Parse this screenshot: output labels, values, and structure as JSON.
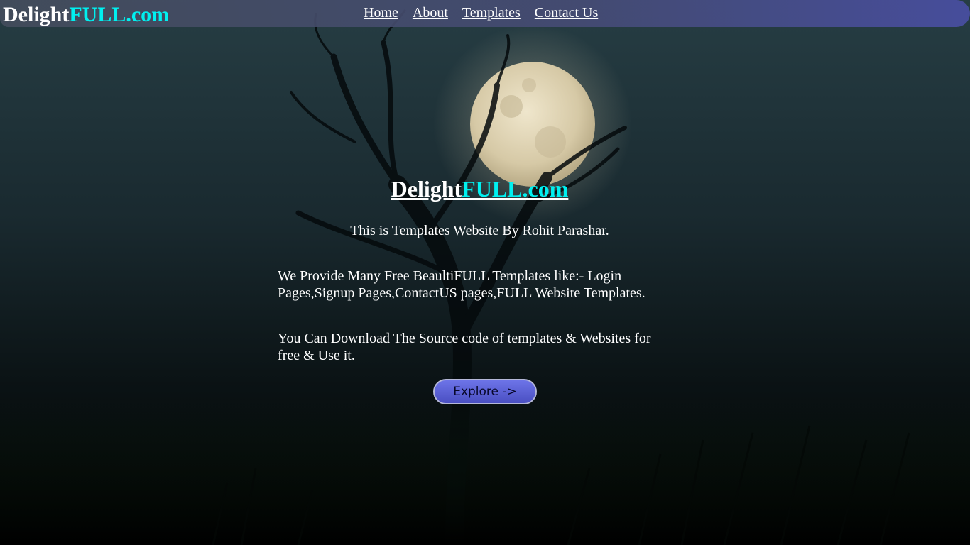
{
  "navbar": {
    "brand_part1": "Delight",
    "brand_part2": "FULL.com",
    "links": [
      {
        "label": "Home"
      },
      {
        "label": "About"
      },
      {
        "label": "Templates"
      },
      {
        "label": "Contact Us"
      }
    ]
  },
  "hero": {
    "title_part1": "Delight",
    "title_part2": "FULL.com",
    "intro": "This is Templates Website By Rohit Parashar.",
    "paragraph1": "We Provide Many Free BeaultiFULL Templates like:- Login Pages,Signup Pages,ContactUS pages,FULL Website Templates.",
    "paragraph2": "You Can Download The Source code of templates & Websites for free & Use it.",
    "button_label": "Explore ->"
  },
  "colors": {
    "accent_cyan": "#00f0f0",
    "button": "#5a60d8",
    "navbar_end": "#4850a0"
  }
}
